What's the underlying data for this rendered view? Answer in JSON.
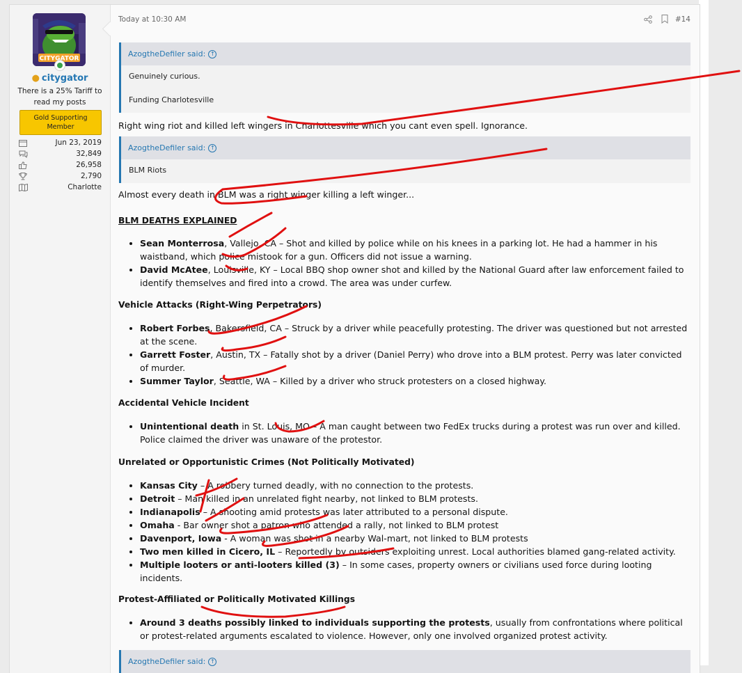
{
  "user": {
    "avatar_label": "CITYGATOR",
    "name": "citygator",
    "title": "There is a 25% Tariff to read my posts",
    "banner": "Gold Supporting Member",
    "stats": [
      {
        "icon": "calendar-icon",
        "value": "Jun 23, 2019"
      },
      {
        "icon": "messages-icon",
        "value": "32,849"
      },
      {
        "icon": "thumbs-up-icon",
        "value": "26,958"
      },
      {
        "icon": "trophy-icon",
        "value": "2,790"
      },
      {
        "icon": "map-icon",
        "value": "Charlotte"
      }
    ]
  },
  "post": {
    "timestamp": "Today at 10:30 AM",
    "number": "#14",
    "quote1": {
      "author": "AzogtheDefiler said:",
      "lines": [
        "Genuinely curious.",
        "Funding Charlotesville"
      ]
    },
    "reply1": "Right wing riot and killed left wingers in Charlottesville which you cant even spell. Ignorance.",
    "quote2": {
      "author": "AzogtheDefiler said:",
      "lines": [
        "BLM Riots"
      ]
    },
    "reply2": "Almost every death in BLM was a right winger killing a left winger...",
    "section_title": "BLM DEATHS EXPLAINED",
    "section1_items": [
      {
        "name": "Sean Monterrosa",
        "text": ", Vallejo, CA – Shot and killed by police while on his knees in a parking lot. He had a hammer in his waistband, which police mistook for a gun. Officers did not issue a warning."
      },
      {
        "name": "David McAtee",
        "text": ", Louisville, KY – Local BBQ shop owner shot and killed by the National Guard after law enforcement failed to identify themselves and fired into a crowd. The area was under curfew."
      }
    ],
    "section2_title": "Vehicle Attacks (Right-Wing Perpetrators)",
    "section2_items": [
      {
        "name": "Robert Forbes",
        "text": ", Bakersfield, CA – Struck by a driver while peacefully protesting. The driver was questioned but not arrested at the scene."
      },
      {
        "name": "Garrett Foster",
        "text": ", Austin, TX – Fatally shot by a driver (Daniel Perry) who drove into a BLM protest. Perry was later convicted of murder."
      },
      {
        "name": "Summer Taylor",
        "text": ", Seattle, WA – Killed by a driver who struck protesters on a closed highway."
      }
    ],
    "section3_title": "Accidental Vehicle Incident",
    "section3_items": [
      {
        "name": "Unintentional death",
        "text": " in St. Louis, MO – A man caught between two FedEx trucks during a protest was run over and killed. Police claimed the driver was unaware of the protestor."
      }
    ],
    "section4_title": "Unrelated or Opportunistic Crimes (Not Politically Motivated)",
    "section4_items": [
      {
        "name": "Kansas City",
        "text": " – A robbery turned deadly, with no connection to the protests."
      },
      {
        "name": "Detroit",
        "text": " – Man killed in an unrelated fight nearby, not linked to BLM protests."
      },
      {
        "name": "Indianapolis",
        "text": " – A shooting amid protests was later attributed to a personal dispute."
      },
      {
        "name": "Omaha",
        "text": " - Bar owner shot a patron who attended a rally, not linked to BLM protest"
      },
      {
        "name": "Davenport, Iowa",
        "text": " - A woman was shot in a nearby Wal-mart, not linked to BLM protests"
      },
      {
        "name": "Two men killed in Cicero, IL",
        "text": " – Reportedly by outsiders exploiting unrest. Local authorities blamed gang-related activity."
      },
      {
        "name": "Multiple looters or anti-looters killed (3)",
        "text": " – In some cases, property owners or civilians used force during looting incidents."
      }
    ],
    "section5_title": "Protest-Affiliated or Politically Motivated Killings",
    "section5_items": [
      {
        "name": "Around 3 deaths possibly linked to individuals supporting the protests",
        "text": ", usually from confrontations where political or protest-related arguments escalated to violence. However, only one involved organized protest activity."
      }
    ],
    "quote3": {
      "author": "AzogtheDefiler said:"
    }
  },
  "colors": {
    "accent": "#2577b1",
    "banner": "#f7c600",
    "ink": "#e01010"
  }
}
